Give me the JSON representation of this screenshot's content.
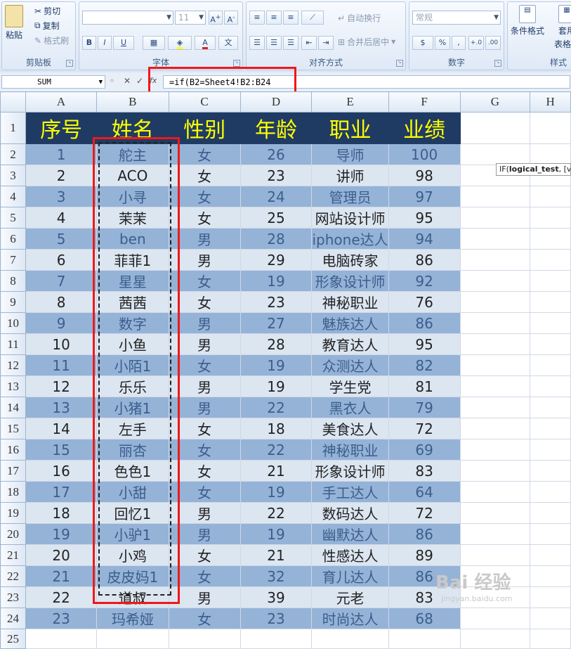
{
  "ribbon": {
    "clipboard": {
      "label": "剪贴板",
      "paste": "粘贴",
      "cut": "剪切",
      "copy": "复制",
      "format_painter": "格式刷"
    },
    "font": {
      "label": "字体",
      "font_name": "",
      "font_size": "11",
      "bold": "B",
      "italic": "I",
      "underline": "U"
    },
    "alignment": {
      "label": "对齐方式",
      "wrap_text": "自动换行",
      "merge_center": "合并后居中"
    },
    "number": {
      "label": "数字",
      "format": "常规",
      "percent": "%"
    },
    "styles": {
      "label": "样式",
      "conditional_format": "条件格式",
      "table_format_1": "套用",
      "table_format_2": "表格格"
    }
  },
  "formula_bar": {
    "name_box": "SUM",
    "fx": "fx",
    "formula": "=if(B2=Sheet4!B2:B24"
  },
  "tooltip": {
    "func": "IF(",
    "arg": "logical_test",
    "rest": ", [v"
  },
  "columns": [
    "A",
    "B",
    "C",
    "D",
    "E",
    "F",
    "G",
    "H"
  ],
  "header_row": [
    "序号",
    "姓名",
    "性别",
    "年龄",
    "职业",
    "业绩"
  ],
  "rows": [
    [
      "1",
      "舵主",
      "女",
      "26",
      "导师",
      "100"
    ],
    [
      "2",
      "ACO",
      "女",
      "23",
      "讲师",
      "98"
    ],
    [
      "3",
      "小寻",
      "女",
      "24",
      "管理员",
      "97"
    ],
    [
      "4",
      "茉茉",
      "女",
      "25",
      "网站设计师",
      "95"
    ],
    [
      "5",
      "ben",
      "男",
      "28",
      "iphone达人",
      "94"
    ],
    [
      "6",
      "菲菲1",
      "男",
      "29",
      "电脑砖家",
      "86"
    ],
    [
      "7",
      "星星",
      "女",
      "19",
      "形象设计师",
      "92"
    ],
    [
      "8",
      "茜茜",
      "女",
      "23",
      "神秘职业",
      "76"
    ],
    [
      "9",
      "数字",
      "男",
      "27",
      "魅族达人",
      "86"
    ],
    [
      "10",
      "小鱼",
      "男",
      "28",
      "教育达人",
      "95"
    ],
    [
      "11",
      "小陌1",
      "女",
      "19",
      "众测达人",
      "82"
    ],
    [
      "12",
      "乐乐",
      "男",
      "19",
      "学生党",
      "81"
    ],
    [
      "13",
      "小猪1",
      "男",
      "22",
      "黑衣人",
      "79"
    ],
    [
      "14",
      "左手",
      "女",
      "18",
      "美食达人",
      "72"
    ],
    [
      "15",
      "丽杏",
      "女",
      "22",
      "神秘职业",
      "69"
    ],
    [
      "16",
      "色色1",
      "女",
      "21",
      "形象设计师",
      "83"
    ],
    [
      "17",
      "小甜",
      "女",
      "19",
      "手工达人",
      "64"
    ],
    [
      "18",
      "回忆1",
      "男",
      "22",
      "数码达人",
      "72"
    ],
    [
      "19",
      "小驴1",
      "男",
      "19",
      "幽默达人",
      "86"
    ],
    [
      "20",
      "小鸡",
      "女",
      "21",
      "性感达人",
      "89"
    ],
    [
      "21",
      "皮皮妈1",
      "女",
      "32",
      "育儿达人",
      "86"
    ],
    [
      "22",
      "道叔",
      "男",
      "39",
      "元老",
      "83"
    ],
    [
      "23",
      "玛希娅",
      "女",
      "23",
      "时尚达人",
      "68"
    ]
  ],
  "watermark": {
    "main": "Bai 经验",
    "sub": "jingyan.baidu.com"
  }
}
